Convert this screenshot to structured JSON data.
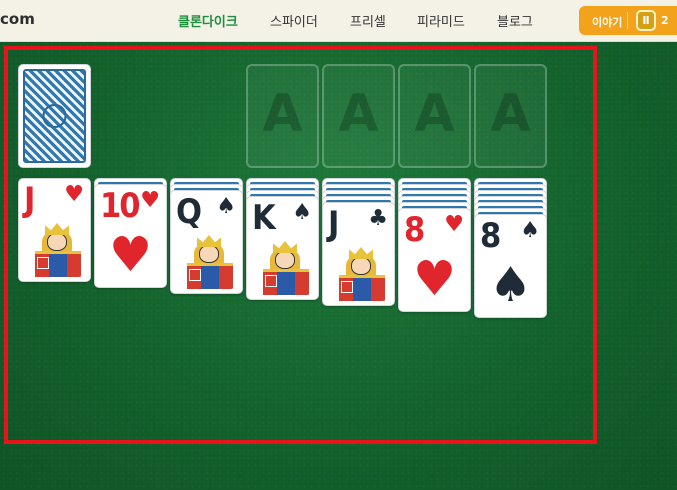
{
  "header": {
    "logo_text": "com",
    "nav": [
      "클론다이크",
      "스파이더",
      "프리셀",
      "피라미드",
      "블로그"
    ],
    "active_index": 0,
    "story_button": {
      "label": "이야기",
      "coin_icon": "coin-icon",
      "count": "2"
    }
  },
  "game": {
    "stock": {
      "face_down": true
    },
    "foundations": [
      "A",
      "A",
      "A",
      "A"
    ],
    "tableau": [
      {
        "face_down": 0,
        "top": {
          "rank": "J",
          "suit": "♥",
          "color": "red",
          "court": true
        }
      },
      {
        "face_down": 1,
        "top": {
          "rank": "10",
          "suit": "♥",
          "color": "red",
          "court": false
        }
      },
      {
        "face_down": 2,
        "top": {
          "rank": "Q",
          "suit": "♠",
          "color": "black",
          "court": true
        }
      },
      {
        "face_down": 3,
        "top": {
          "rank": "K",
          "suit": "♠",
          "color": "black",
          "court": true
        }
      },
      {
        "face_down": 4,
        "top": {
          "rank": "J",
          "suit": "♣",
          "color": "black",
          "court": true
        }
      },
      {
        "face_down": 5,
        "top": {
          "rank": "8",
          "suit": "♥",
          "color": "red",
          "court": false
        }
      },
      {
        "face_down": 6,
        "top": {
          "rank": "8",
          "suit": "♠",
          "color": "black",
          "court": false
        }
      }
    ]
  },
  "colors": {
    "felt": "#1b6e35",
    "header_bg": "#f4f1e6",
    "nav_active": "#1e8f3f",
    "story_button": "#f3a21b",
    "highlight_border": "#e8141b",
    "red_suit": "#e1252c",
    "black_suit": "#1f2b36"
  }
}
